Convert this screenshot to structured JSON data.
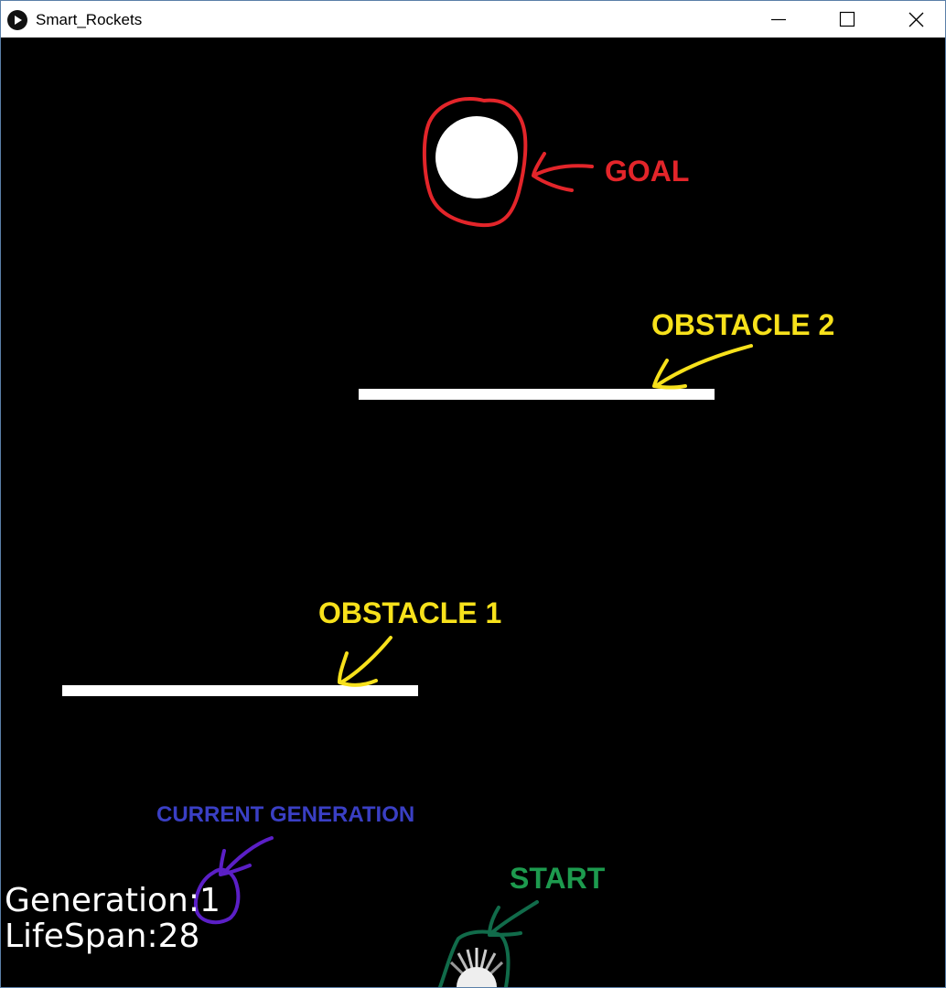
{
  "window": {
    "title": "Smart_Rockets",
    "app_icon": "processing-play-icon",
    "controls": {
      "minimize": "minimize-icon",
      "maximize": "maximize-icon",
      "close": "close-icon"
    },
    "border_color": "#5a7fa8"
  },
  "hud": {
    "generation_text": "Generation:1",
    "lifespan_text": "LifeSpan:28"
  },
  "annotations": {
    "goal": "GOAL",
    "obstacle_2": "OBSTACLE 2",
    "obstacle_1": "OBSTACLE 1",
    "current_generation": "CURRENT GENERATION",
    "start": "START"
  },
  "colors": {
    "background": "#000000",
    "sprites": "#ffffff",
    "goal_annotation": "#e3252a",
    "obstacle_annotation": "#f7e11b",
    "generation_annotation": "#3a3fc4",
    "generation_marker": "#5b1fc6",
    "start_annotation": "#1d9a4e",
    "start_marker": "#116b4a"
  }
}
